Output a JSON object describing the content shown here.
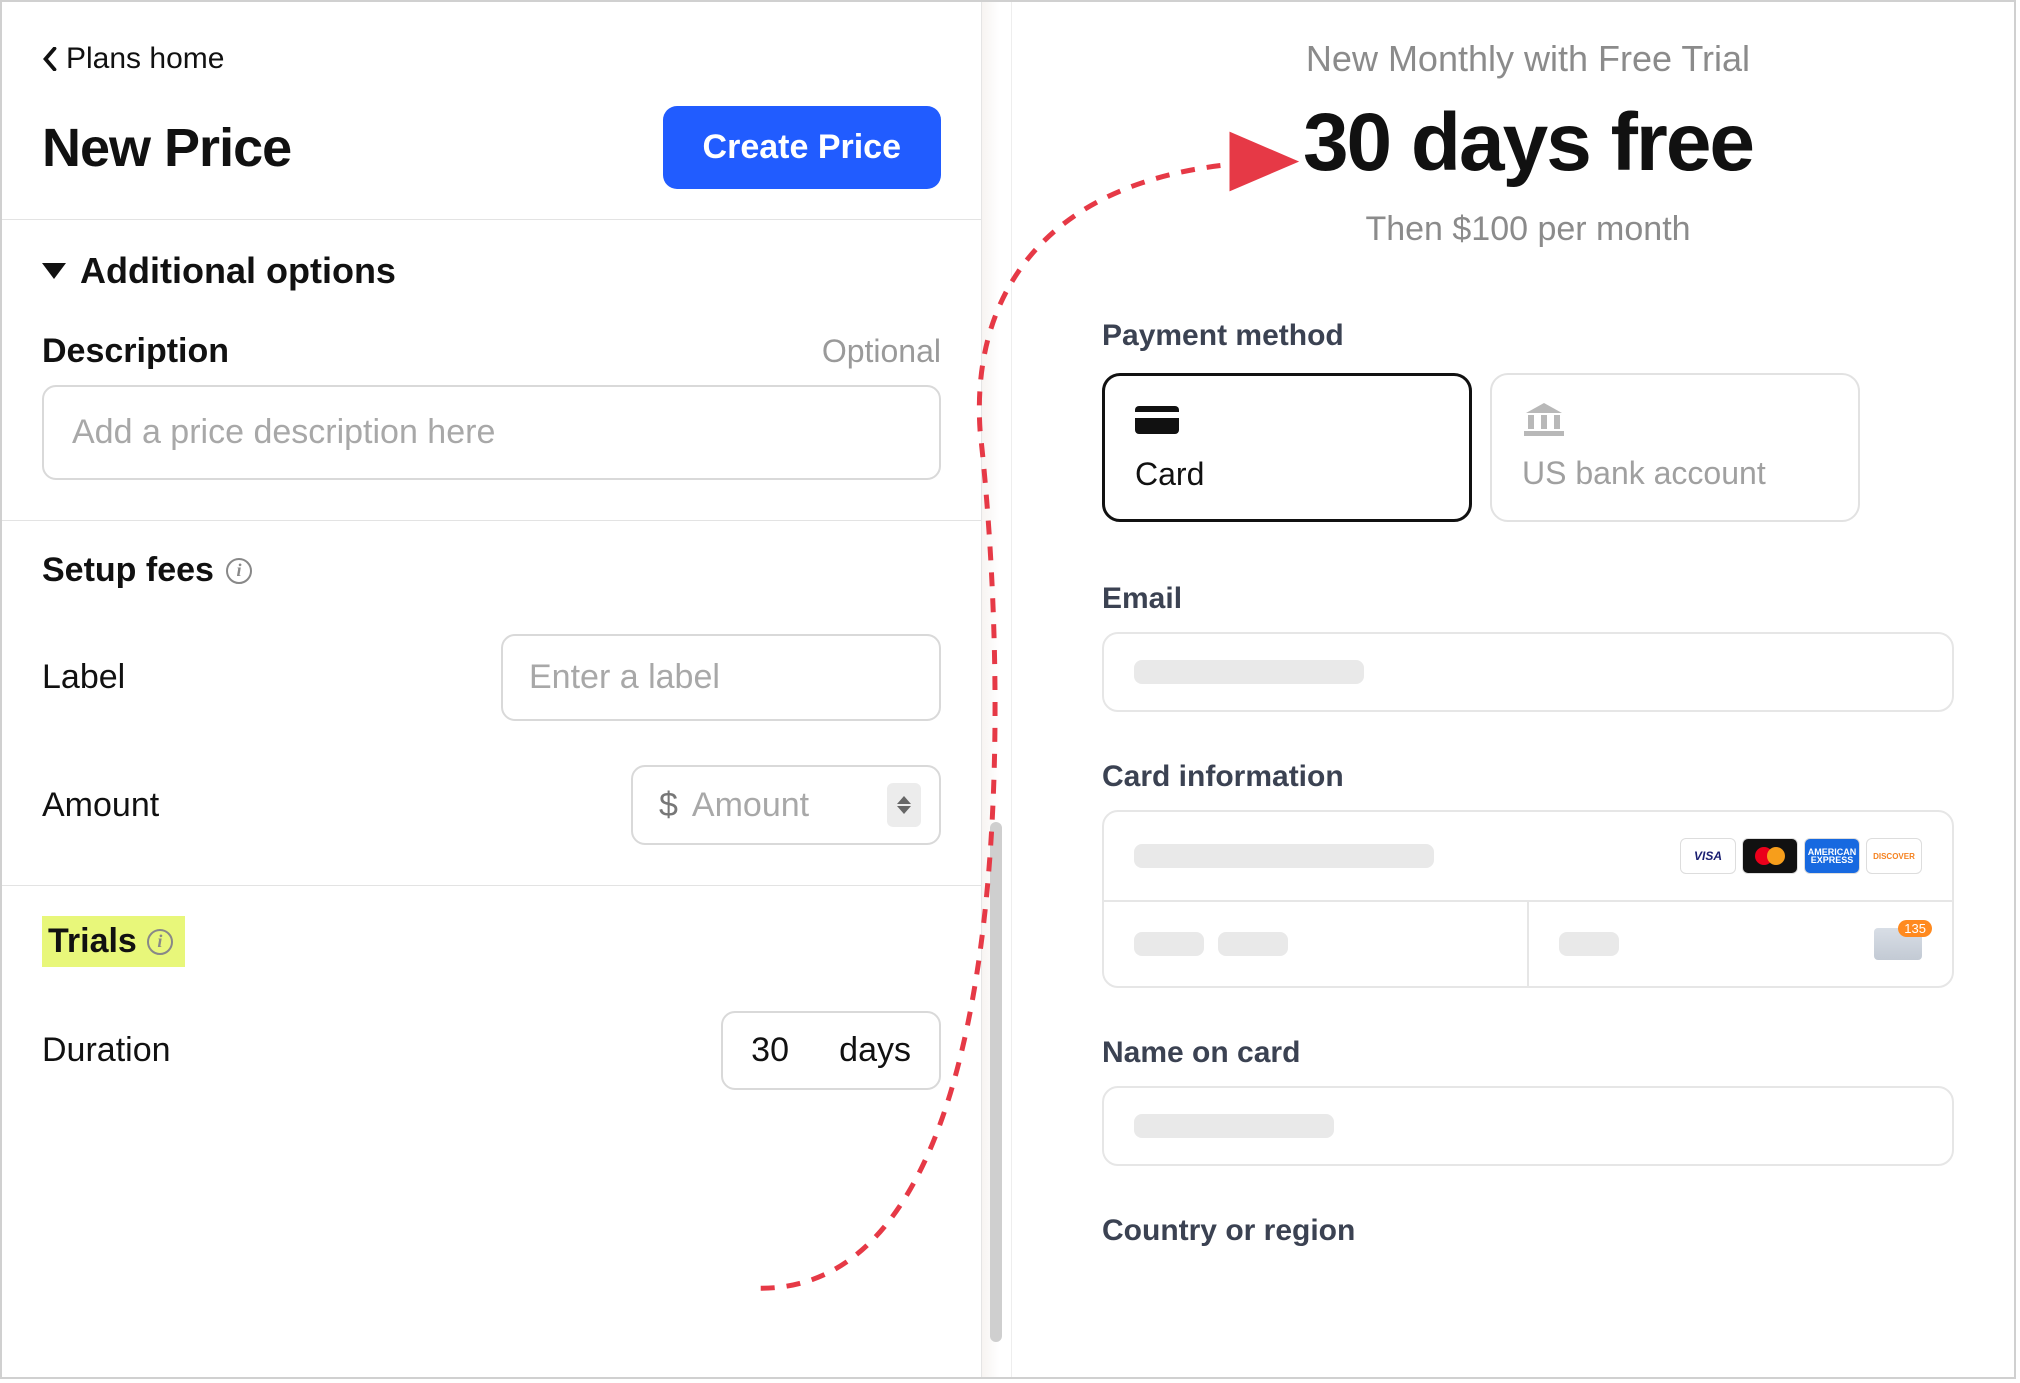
{
  "left": {
    "breadcrumb": "Plans home",
    "title": "New Price",
    "create_button": "Create Price",
    "accordion_label": "Additional options",
    "description": {
      "label": "Description",
      "optional": "Optional",
      "placeholder": "Add a price description here"
    },
    "setup_fees": {
      "heading": "Setup fees",
      "label_row": "Label",
      "label_placeholder": "Enter a label",
      "amount_row": "Amount",
      "currency_symbol": "$",
      "amount_placeholder": "Amount"
    },
    "trials": {
      "heading": "Trials",
      "duration_label": "Duration",
      "duration_value": "30",
      "duration_unit": "days"
    }
  },
  "right": {
    "subtitle": "New Monthly with Free Trial",
    "headline": "30 days free",
    "sub2": "Then $100 per month",
    "payment_method_label": "Payment method",
    "card_option": "Card",
    "bank_option": "US bank account",
    "email_label": "Email",
    "card_info_label": "Card information",
    "name_label": "Name on card",
    "country_label": "Country or region",
    "brands": {
      "visa": "VISA",
      "mc": "",
      "amex": "",
      "discover": "DISCOVER"
    },
    "cvc_badge": "135"
  }
}
